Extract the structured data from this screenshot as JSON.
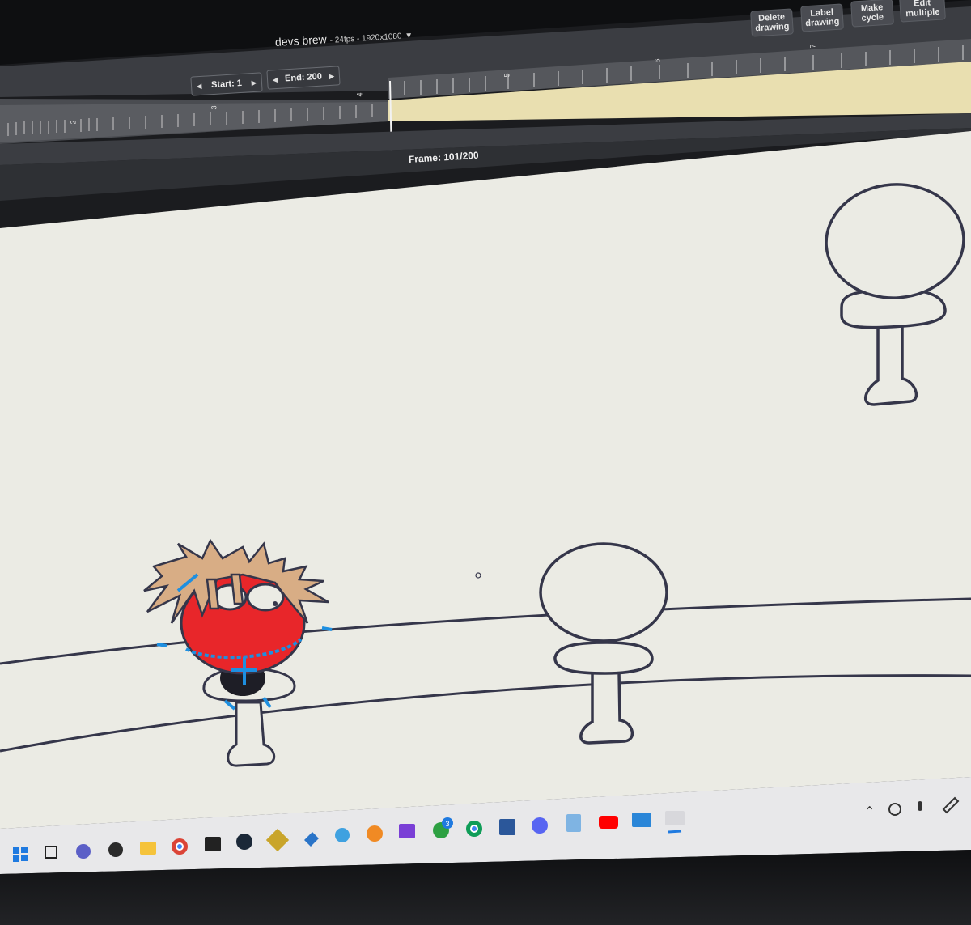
{
  "window": {
    "project_name": "devs brew",
    "project_meta": "- 24fps - 1920x1080",
    "dropdown_arrow": "▼"
  },
  "toolbar": {
    "delete_drawing": "Delete\ndrawing",
    "label_drawing": "Label\ndrawing",
    "make_cycle": "Make\ncycle",
    "edit_multiple": "Edit\nmultiple"
  },
  "timeline": {
    "start_label": "Start: 1",
    "end_label": "End: 200",
    "frame_label": "Frame: 101/200",
    "current_frame": 101,
    "total_frames": 200,
    "ruler_marks": [
      "2",
      "3",
      "4",
      "5",
      "6",
      "7"
    ]
  },
  "colors": {
    "ui_dark": "#3a3c41",
    "timeline_highlight": "#e9dfb0",
    "canvas": "#ebebe4",
    "character_red": "#e8262a",
    "hair": "#d8ad85",
    "rig_blue": "#1e8fe0",
    "line": "#35364a"
  },
  "taskbar": {
    "icons": [
      "windows-icon",
      "task-view-icon",
      "teams-icon",
      "obs-icon",
      "file-explorer-icon",
      "chrome-icon",
      "app-icon",
      "steam-icon",
      "game-icon",
      "vscode-icon",
      "paint-icon",
      "fl-studio-icon",
      "stack-icon",
      "xbox-icon",
      "chrome-icon",
      "word-icon",
      "discord-icon",
      "notepad-icon",
      "youtube-icon",
      "photos-icon",
      "animation-app-icon"
    ],
    "xbox_badge": "3",
    "tray_icons": [
      "chevron-up-icon",
      "sync-icon",
      "microphone-icon",
      "pen-icon"
    ]
  }
}
